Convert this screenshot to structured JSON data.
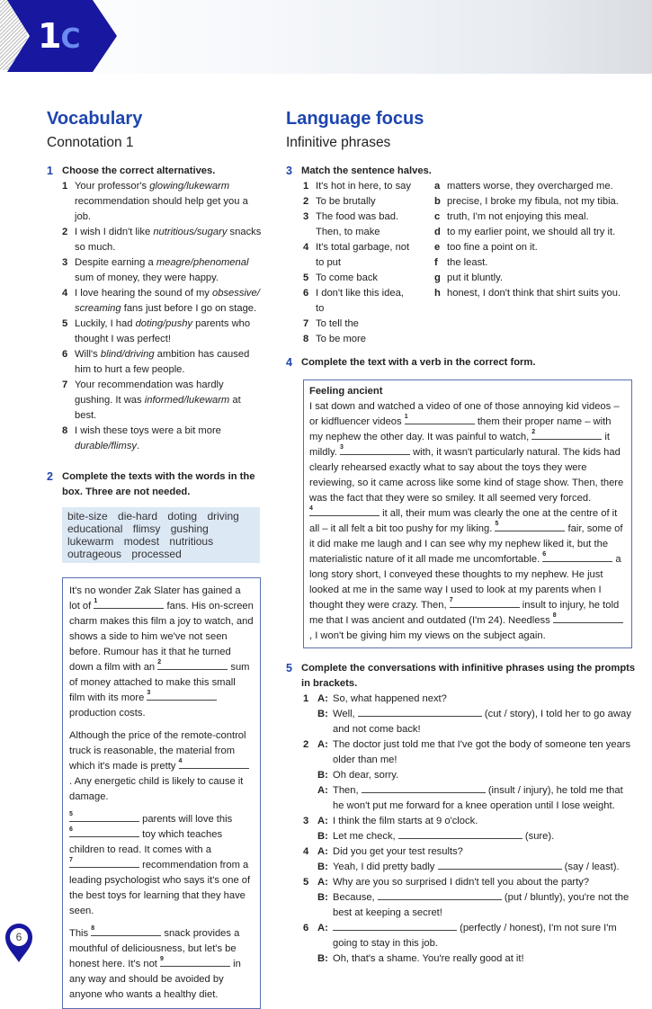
{
  "header": {
    "unit_number": "1",
    "unit_letter": "C",
    "brand_color": "#1717a0",
    "accent_color": "#6c8af0"
  },
  "left": {
    "title": "Vocabulary",
    "subtitle": "Connotation 1",
    "ex1": {
      "num": "1",
      "instruction": "Choose the correct alternatives.",
      "items": [
        {
          "n": "1",
          "text": [
            "Your professor's ",
            {
              "i": "glowing/lukewarm"
            },
            " recommendation should help get you a job."
          ]
        },
        {
          "n": "2",
          "text": [
            "I wish I didn't like ",
            {
              "i": "nutritious/sugary"
            },
            " snacks so much."
          ]
        },
        {
          "n": "3",
          "text": [
            "Despite earning a ",
            {
              "i": "meagre/phenomenal"
            },
            " sum of money, they were happy."
          ]
        },
        {
          "n": "4",
          "text": [
            "I love hearing the sound of my ",
            {
              "i": "obsessive/ screaming"
            },
            " fans just before I go on stage."
          ]
        },
        {
          "n": "5",
          "text": [
            "Luckily, I had ",
            {
              "i": "doting/pushy"
            },
            " parents who thought I was perfect!"
          ]
        },
        {
          "n": "6",
          "text": [
            "Will's ",
            {
              "i": "blind/driving"
            },
            " ambition has caused him to hurt a few people."
          ]
        },
        {
          "n": "7",
          "text": [
            "Your recommendation was hardly gushing. It was ",
            {
              "i": "informed/lukewarm"
            },
            " at best."
          ]
        },
        {
          "n": "8",
          "text": [
            "I wish these toys were a bit more ",
            {
              "i": "durable/flimsy"
            },
            "."
          ]
        }
      ]
    },
    "ex2": {
      "num": "2",
      "instruction": "Complete the texts with the words in the box. Three are not needed.",
      "words": [
        "bite-size",
        "die-hard",
        "doting",
        "driving",
        "educational",
        "flimsy",
        "gushing",
        "lukewarm",
        "modest",
        "nutritious",
        "outrageous",
        "processed"
      ],
      "paragraphs": [
        [
          "It's no wonder Zak Slater has gained a lot of ",
          {
            "n": "1"
          },
          " fans. His on-screen charm makes this film a joy to watch, and shows a side to him we've not seen before. Rumour has it that he turned down a film with an ",
          {
            "n": "2"
          },
          " sum of money attached to make this small film with its more ",
          {
            "n": "3"
          },
          " production costs."
        ],
        [
          "Although the price of the remote-control truck is reasonable, the material from which it's made is pretty ",
          {
            "n": "4"
          },
          " . Any energetic child is likely to cause it damage."
        ],
        [
          {
            "n": "5"
          },
          " parents will love this ",
          {
            "n": "6"
          },
          " toy which teaches children to read. It comes with a ",
          {
            "n": "7"
          },
          " recommendation from a leading psychologist who says it's one of the best toys for learning that they have seen."
        ],
        [
          "This ",
          {
            "n": "8"
          },
          " snack provides a mouthful of deliciousness, but let's be honest here. It's not ",
          {
            "n": "9"
          },
          " in any way and should be avoided by anyone who wants a healthy diet."
        ]
      ]
    }
  },
  "right": {
    "title": "Language focus",
    "subtitle": "Infinitive phrases",
    "ex3": {
      "num": "3",
      "instruction": "Match the sentence halves.",
      "left": [
        {
          "n": "1",
          "t": "It's hot in here, to say"
        },
        {
          "n": "2",
          "t": "To be brutally"
        },
        {
          "n": "3",
          "t": "The food was bad. Then, to make"
        },
        {
          "n": "4",
          "t": "It's total garbage, not to put"
        },
        {
          "n": "5",
          "t": "To come back"
        },
        {
          "n": "6",
          "t": "I don't like this idea, to"
        },
        {
          "n": "7",
          "t": "To tell the"
        },
        {
          "n": "8",
          "t": "To be more"
        }
      ],
      "right": [
        {
          "n": "a",
          "t": "matters worse, they overcharged me."
        },
        {
          "n": "b",
          "t": "precise, I broke my fibula, not my tibia."
        },
        {
          "n": "c",
          "t": "truth, I'm not enjoying this meal."
        },
        {
          "n": "d",
          "t": "to my earlier point, we should all try it."
        },
        {
          "n": "e",
          "t": "too fine a point on it."
        },
        {
          "n": "f",
          "t": "the least."
        },
        {
          "n": "g",
          "t": "put it bluntly."
        },
        {
          "n": "h",
          "t": "honest, I don't think that shirt suits you."
        }
      ]
    },
    "ex4": {
      "num": "4",
      "instruction": "Complete the text with a verb in the correct form.",
      "box_title": "Feeling ancient",
      "text": [
        "I sat down and watched a video of one of those annoying kid videos – or kidfluencer videos ",
        {
          "n": "1"
        },
        " them their proper name – with my nephew the other day. It was painful to watch, ",
        {
          "n": "2"
        },
        " it mildly. ",
        {
          "n": "3"
        },
        " with, it wasn't particularly natural. The kids had clearly rehearsed exactly what to say about the toys they were reviewing, so it came across like some kind of stage show. Then, there was the fact that they were so smiley. It all seemed very forced. ",
        {
          "n": "4"
        },
        " it all, their mum was clearly the one at the centre of it all – it all felt a bit too pushy for my liking. ",
        {
          "n": "5"
        },
        " fair, some of it did make me laugh and I can see why my nephew liked it, but the materialistic nature of it all made me uncomfortable. ",
        {
          "n": "6"
        },
        " a long story short, I conveyed these thoughts to my nephew. He just looked at me in the same way I used to look at my parents when I thought they were crazy. Then, ",
        {
          "n": "7"
        },
        " insult to injury, he told me that I was ancient and outdated (I'm 24). Needless ",
        {
          "n": "8"
        },
        " , I won't be giving him my views on the subject again."
      ]
    },
    "ex5": {
      "num": "5",
      "instruction": "Complete the conversations with infinitive phrases using the prompts in brackets.",
      "items": [
        {
          "n": "1",
          "lines": [
            {
              "sp": "A:",
              "text": [
                "So, what happened next?"
              ]
            },
            {
              "sp": "B:",
              "text": [
                "Well, ",
                {
                  "blank": true
                },
                " (cut / story), I told her to go away and not come back!"
              ]
            }
          ]
        },
        {
          "n": "2",
          "lines": [
            {
              "sp": "A:",
              "text": [
                "The doctor just told me that I've got the body of someone ten years older than me!"
              ]
            },
            {
              "sp": "B:",
              "text": [
                "Oh dear, sorry."
              ]
            },
            {
              "sp": "A:",
              "text": [
                "Then, ",
                {
                  "blank": true
                },
                " (insult / injury), he told me that he won't put me forward for a knee operation until I lose weight."
              ]
            }
          ]
        },
        {
          "n": "3",
          "lines": [
            {
              "sp": "A:",
              "text": [
                "I think the film starts at 9 o'clock."
              ]
            },
            {
              "sp": "B:",
              "text": [
                "Let me check, ",
                {
                  "blank": true
                },
                " (sure)."
              ]
            }
          ]
        },
        {
          "n": "4",
          "lines": [
            {
              "sp": "A:",
              "text": [
                "Did you get your test results?"
              ]
            },
            {
              "sp": "B:",
              "text": [
                "Yeah, I did pretty badly ",
                {
                  "blank": true
                },
                " (say / least)."
              ]
            }
          ]
        },
        {
          "n": "5",
          "lines": [
            {
              "sp": "A:",
              "text": [
                "Why are you so surprised I didn't tell you about the party?"
              ]
            },
            {
              "sp": "B:",
              "text": [
                "Because, ",
                {
                  "blank": true
                },
                " (put / bluntly), you're not the best at keeping a secret!"
              ]
            }
          ]
        },
        {
          "n": "6",
          "lines": [
            {
              "sp": "A:",
              "text": [
                {
                  "blank": true
                },
                " (perfectly / honest), I'm not sure I'm going to stay in this job."
              ]
            },
            {
              "sp": "B:",
              "text": [
                "Oh, that's a shame. You're really good at it!"
              ]
            }
          ]
        }
      ]
    }
  },
  "footer": {
    "page_number": "6"
  }
}
